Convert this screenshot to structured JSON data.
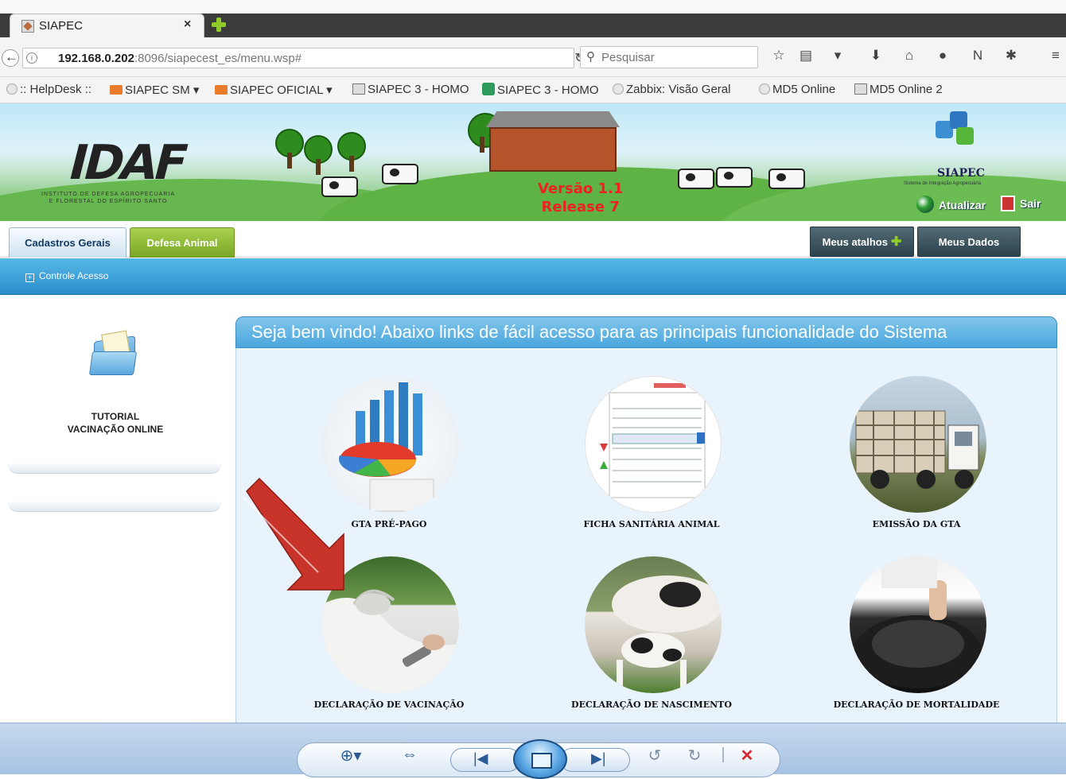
{
  "browser": {
    "tab_title": "SIAPEC",
    "url_host": "192.168.0.202",
    "url_rest": ":8096/siapecest_es/menu.wsp#",
    "search_placeholder": "Pesquisar",
    "bookmarks": [
      ":: HelpDesk ::",
      "SIAPEC SM ▾",
      "SIAPEC OFICIAL ▾",
      "SIAPEC 3 - HOMO",
      "SIAPEC 3 - HOMO",
      "Zabbix: Visão Geral",
      "MD5 Online",
      "MD5 Online 2"
    ]
  },
  "banner": {
    "org_logo": "IDAF",
    "org_subtitle_1": "INSTITUTO DE DEFESA AGROPECUÁRIA",
    "org_subtitle_2": "E FLORESTAL DO ESPÍRITO SANTO",
    "version_1": "Versão 1.1",
    "version_2": "Release 7",
    "brand": "SIAPEC",
    "tagline": "Sistema de Integração Agropecuária",
    "atualizar": "Atualizar",
    "sair": "Sair"
  },
  "nav": {
    "tab_cadastros": "Cadastros Gerais",
    "tab_defesa": "Defesa Animal",
    "meus_atalhos": "Meus atalhos",
    "meus_dados": "Meus Dados",
    "controle_acesso": "Controle Acesso"
  },
  "sidebar": {
    "tutorial_line1": "TUTORIAL",
    "tutorial_line2": "VACINAÇÃO ONLINE"
  },
  "welcome": {
    "heading": "Seja bem vindo! Abaixo links de fácil acesso para as principais funcionalidade do Sistema",
    "shortcuts": [
      "GTA PRÉ-PAGO",
      "FICHA SANITÁRIA ANIMAL",
      "EMISSÃO DA GTA",
      "DECLARAÇÃO DE VACINAÇÃO",
      "DECLARAÇÃO DE NASCIMENTO",
      "DECLARAÇÃO DE MORTALIDADE"
    ]
  },
  "colors": {
    "accent_blue": "#2a8dcb",
    "defesa_green": "#7aa625",
    "version_red": "#e22222",
    "arrow_red": "#c8332a"
  }
}
